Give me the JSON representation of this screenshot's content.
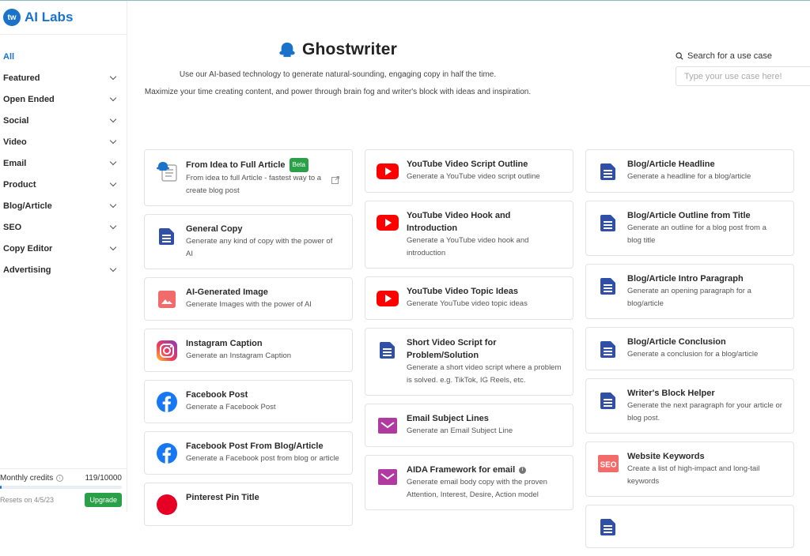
{
  "brand": {
    "logo": "tw",
    "name": "AI Labs"
  },
  "sidebar": {
    "items": [
      {
        "label": "All",
        "active": true,
        "expandable": false
      },
      {
        "label": "Featured",
        "expandable": true
      },
      {
        "label": "Open Ended",
        "expandable": true
      },
      {
        "label": "Social",
        "expandable": true
      },
      {
        "label": "Video",
        "expandable": true
      },
      {
        "label": "Email",
        "expandable": true
      },
      {
        "label": "Product",
        "expandable": true
      },
      {
        "label": "Blog/Article",
        "expandable": true
      },
      {
        "label": "SEO",
        "expandable": true
      },
      {
        "label": "Copy Editor",
        "expandable": true
      },
      {
        "label": "Advertising",
        "expandable": true
      }
    ],
    "credits": {
      "label": "Monthly credits",
      "value": "119/10000",
      "used": 119,
      "total": 10000,
      "resets": "Resets on 4/5/23",
      "upgrade_label": "Upgrade"
    }
  },
  "hero": {
    "title": "Ghostwriter",
    "subtitle1": "Use our AI-based technology to generate natural-sounding, engaging copy in half the time.",
    "subtitle2": "Maximize your time creating content, and power through brain fog and writer's block with ideas and inspiration."
  },
  "search": {
    "label": "Search for a use case",
    "placeholder": "Type your use case here!",
    "value": ""
  },
  "colors": {
    "brand": "#1a73c9",
    "upgrade": "#2aa048",
    "youtube": "#ff0000",
    "doc": "#2f4fa8",
    "email": "#b03a9f",
    "image": "#f26b6b",
    "facebook": "#1877f2"
  },
  "columns": [
    [
      {
        "icon": "ghost-doc-icon",
        "title": "From Idea to Full Article",
        "badge": "Beta",
        "desc": "From idea to full Article - fastest way to a create blog post",
        "external": true
      },
      {
        "icon": "document-icon",
        "title": "General Copy",
        "desc": "Generate any kind of copy with the power of AI"
      },
      {
        "icon": "image-icon",
        "title": "AI-Generated Image",
        "desc": "Generate Images with the power of AI"
      },
      {
        "icon": "instagram-icon",
        "title": "Instagram Caption",
        "desc": "Generate an Instagram Caption"
      },
      {
        "icon": "facebook-icon",
        "title": "Facebook Post",
        "desc": "Generate a Facebook Post"
      },
      {
        "icon": "facebook-icon",
        "title": "Facebook Post From Blog/Article",
        "desc": "Generate a Facebook post from blog or article"
      },
      {
        "icon": "pinterest-icon",
        "title": "Pinterest Pin Title",
        "desc": ""
      }
    ],
    [
      {
        "icon": "youtube-icon",
        "title": "YouTube Video Script Outline",
        "desc": "Generate a YouTube video script outline"
      },
      {
        "icon": "youtube-icon",
        "title": "YouTube Video Hook and Introduction",
        "desc": "Generate a YouTube video hook and introduction"
      },
      {
        "icon": "youtube-icon",
        "title": "YouTube Video Topic Ideas",
        "desc": "Generate YouTube video topic ideas"
      },
      {
        "icon": "document-icon",
        "title": "Short Video Script for Problem/Solution",
        "desc": "Generate a short video script where a problem is solved. e.g. TikTok, IG Reels, etc."
      },
      {
        "icon": "email-icon",
        "title": "Email Subject Lines",
        "desc": "Generate an Email Subject Line"
      },
      {
        "icon": "email-icon",
        "title": "AIDA Framework for email",
        "info": true,
        "desc": "Generate email body copy with the proven Attention, Interest, Desire, Action model"
      }
    ],
    [
      {
        "icon": "document-icon",
        "title": "Blog/Article Headline",
        "desc": "Generate a headline for a blog/article"
      },
      {
        "icon": "document-icon",
        "title": "Blog/Article Outline from Title",
        "desc": "Generate an outline for a blog post from a blog title"
      },
      {
        "icon": "document-icon",
        "title": "Blog/Article Intro Paragraph",
        "desc": "Generate an opening paragraph for a blog/article"
      },
      {
        "icon": "document-icon",
        "title": "Blog/Article Conclusion",
        "desc": "Generate a conclusion for a blog/article"
      },
      {
        "icon": "document-icon",
        "title": "Writer's Block Helper",
        "desc": "Generate the next paragraph for your article or blog post."
      },
      {
        "icon": "seo-icon",
        "title": "Website Keywords",
        "desc": "Create a list of high-impact and long-tail keywords"
      },
      {
        "icon": "document-icon",
        "title": "",
        "desc": ""
      }
    ]
  ]
}
